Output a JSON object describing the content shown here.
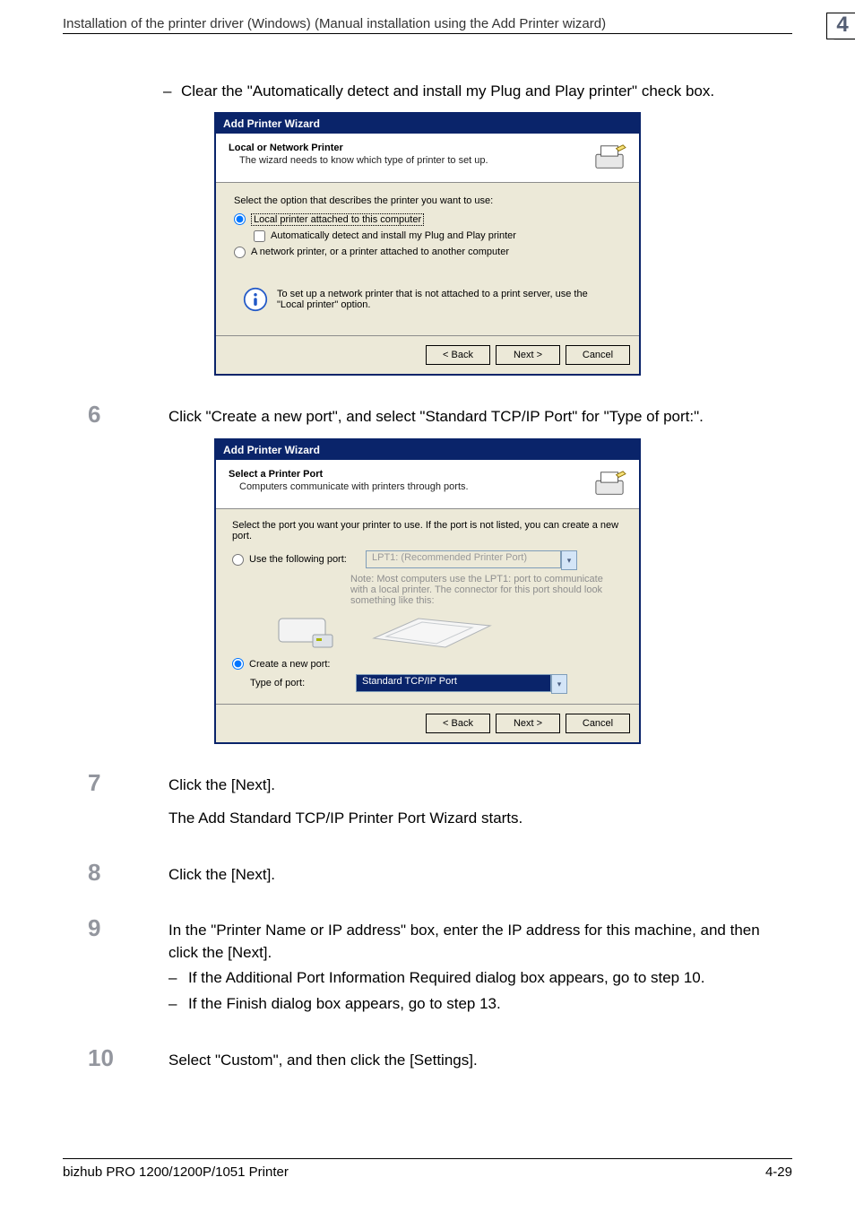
{
  "header": {
    "breadcrumb": "Installation of the printer driver (Windows) (Manual installation using the Add Printer wizard)",
    "chapter": "4"
  },
  "intro_bullet": "Clear the \"Automatically detect and install my Plug and Play printer\" check box.",
  "dialog1": {
    "title": "Add Printer Wizard",
    "heading": "Local or Network Printer",
    "sub": "The wizard needs to know which type of printer to set up.",
    "body_lead": "Select the option that describes the printer you want to use:",
    "opt_local": "Local printer attached to this computer",
    "chk_auto": "Automatically detect and install my Plug and Play printer",
    "opt_network": "A network printer, or a printer attached to another computer",
    "info": "To set up a network printer that is not attached to a print server, use the \"Local printer\" option.",
    "btn_back": "< Back",
    "btn_next": "Next >",
    "btn_cancel": "Cancel"
  },
  "step6": "Click \"Create a new port\", and select \"Standard TCP/IP Port\" for \"Type of port:\".",
  "dialog2": {
    "title": "Add Printer Wizard",
    "heading": "Select a Printer Port",
    "sub": "Computers communicate with printers through ports.",
    "body_lead": "Select the port you want your printer to use.  If the port is not listed, you can create a new port.",
    "opt_use": "Use the following port:",
    "use_value": "LPT1: (Recommended Printer Port)",
    "note": "Note: Most computers use the LPT1: port to communicate with a local printer. The connector for this port should look something like this:",
    "opt_create": "Create a new port:",
    "type_label": "Type of port:",
    "type_value": "Standard TCP/IP Port",
    "btn_back": "< Back",
    "btn_next": "Next >",
    "btn_cancel": "Cancel"
  },
  "step7_a": "Click the [Next].",
  "step7_b": "The Add Standard TCP/IP Printer Port Wizard starts.",
  "step8": "Click the [Next].",
  "step9_a": "In the \"Printer Name or IP address\" box, enter the IP address for this machine, and then click the [Next].",
  "step9_b1": "If the Additional Port Information Required dialog box appears, go to step 10.",
  "step9_b2": "If the Finish dialog box appears, go to step 13.",
  "step10": "Select \"Custom\", and then click the [Settings].",
  "footer": {
    "left": "bizhub PRO 1200/1200P/1051 Printer",
    "right": "4-29"
  },
  "nums": {
    "n6": "6",
    "n7": "7",
    "n8": "8",
    "n9": "9",
    "n10": "10"
  }
}
